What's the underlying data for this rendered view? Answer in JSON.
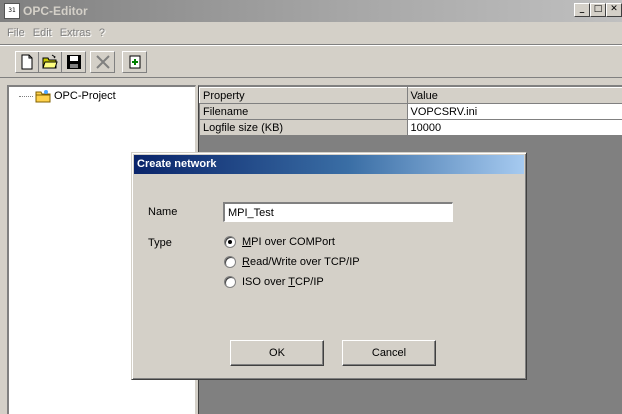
{
  "window": {
    "title": "OPC-Editor",
    "icon_text": "31"
  },
  "menu": [
    {
      "label": "File"
    },
    {
      "label": "Edit"
    },
    {
      "label": "Extras"
    },
    {
      "label": "?"
    }
  ],
  "toolbar": {
    "buttons": [
      "new-file-icon",
      "open-folder-icon",
      "save-icon",
      "delete-icon",
      "export-icon"
    ]
  },
  "tree": {
    "root_label": "OPC-Project"
  },
  "properties": {
    "header": {
      "property": "Property",
      "value": "Value"
    },
    "rows": [
      {
        "property": "Filename",
        "value": "VOPCSRV.ini"
      },
      {
        "property": "Logfile size (KB)",
        "value": "10000"
      }
    ]
  },
  "dialog": {
    "title": "Create network",
    "name_label": "Name",
    "name_value": "MPI_Test",
    "type_label": "Type",
    "options": [
      {
        "prefix": "",
        "accel": "M",
        "rest": "PI over COMPort",
        "checked": true
      },
      {
        "prefix": "",
        "accel": "R",
        "rest": "ead/Write over TCP/IP",
        "checked": false
      },
      {
        "prefix": "ISO over ",
        "accel": "T",
        "rest": "CP/IP",
        "checked": false
      }
    ],
    "ok_label": "OK",
    "cancel_label": "Cancel"
  },
  "colors": {
    "face": "#d4d0c8",
    "dialog_title": "#0a246a",
    "inactive_title": "#808080"
  }
}
